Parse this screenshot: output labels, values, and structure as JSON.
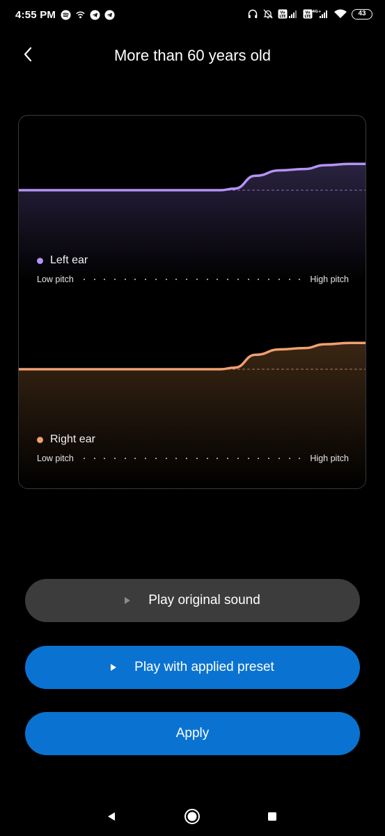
{
  "status_bar": {
    "time": "4:55 PM",
    "battery": "43",
    "left_icons": [
      "spotify-icon",
      "wifi-calling-icon",
      "telegram-icon",
      "telegram-icon"
    ],
    "right_icons": [
      "headphones-icon",
      "bell-off-icon",
      "volte-signal-icon",
      "volte-4g-signal-icon",
      "wifi-icon",
      "battery-icon"
    ]
  },
  "header": {
    "title": "More than 60 years old",
    "back_icon": "chevron-left-icon"
  },
  "chart_data": [
    {
      "type": "line",
      "series": [
        {
          "name": "Left ear",
          "color": "#b493f5",
          "x": [
            0,
            0.58,
            0.62,
            0.68,
            0.75,
            0.82,
            0.88,
            0.95,
            1.0
          ],
          "y": [
            0,
            0,
            0.05,
            0.45,
            0.62,
            0.66,
            0.78,
            0.82,
            0.82
          ]
        }
      ],
      "xlabel_left": "Low pitch",
      "xlabel_right": "High pitch",
      "baseline_dashed": true,
      "grid": false
    },
    {
      "type": "line",
      "series": [
        {
          "name": "Right ear",
          "color": "#f0a070",
          "x": [
            0,
            0.58,
            0.62,
            0.68,
            0.75,
            0.82,
            0.88,
            0.95,
            1.0
          ],
          "y": [
            0,
            0,
            0.05,
            0.45,
            0.62,
            0.66,
            0.78,
            0.82,
            0.82
          ]
        }
      ],
      "xlabel_left": "Low pitch",
      "xlabel_right": "High pitch",
      "baseline_dashed": true,
      "grid": false
    }
  ],
  "left_ear": {
    "label": "Left ear",
    "low_label": "Low pitch",
    "high_label": "High pitch",
    "color": "#b493f5"
  },
  "right_ear": {
    "label": "Right ear",
    "low_label": "Low pitch",
    "high_label": "High pitch",
    "color": "#f0a070"
  },
  "buttons": {
    "play_original": "Play original sound",
    "play_preset": "Play with applied preset",
    "apply": "Apply"
  },
  "colors": {
    "accent_blue": "#0a73d1",
    "button_gray": "#3c3c3c",
    "background": "#000000"
  },
  "nav_bar": {
    "icons": [
      "back-triangle-icon",
      "home-circle-icon",
      "recents-square-icon"
    ]
  }
}
